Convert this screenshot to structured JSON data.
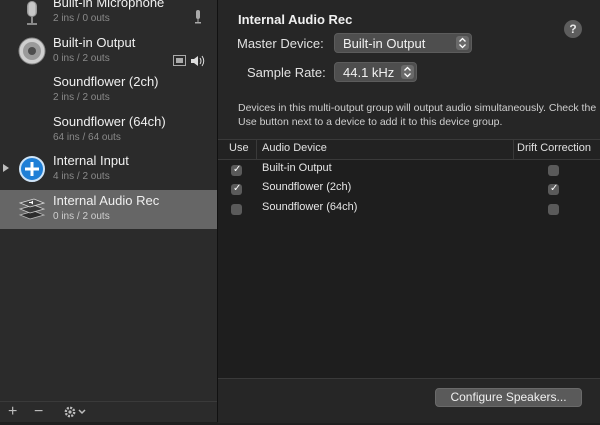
{
  "sidebar": {
    "devices": [
      {
        "name": "Built-in Microphone",
        "sub": "2 ins / 0 outs",
        "icon": "microphone-icon"
      },
      {
        "name": "Built-in Output",
        "sub": "0 ins / 2 outs",
        "icon": "speaker-icon"
      },
      {
        "name": "Soundflower (2ch)",
        "sub": "2 ins / 2 outs",
        "icon": ""
      },
      {
        "name": "Soundflower (64ch)",
        "sub": "64 ins / 64 outs",
        "icon": ""
      },
      {
        "name": "Internal Input",
        "sub": "4 ins / 2 outs",
        "icon": "aggregate-plus-icon"
      },
      {
        "name": "Internal Audio Rec",
        "sub": "0 ins / 2 outs",
        "icon": "multi-output-icon"
      }
    ],
    "bottom": {
      "add": "+",
      "remove": "−"
    }
  },
  "main": {
    "title": "Internal Audio Rec",
    "help": "?",
    "master_label": "Master Device:",
    "master_value": "Built-in Output",
    "rate_label": "Sample Rate:",
    "rate_value": "44.1 kHz",
    "description": "Devices in this multi-output group will output audio simultaneously. Check the Use button next to a device to add it to this device group.",
    "table": {
      "headers": {
        "use": "Use",
        "device": "Audio Device",
        "drift": "Drift Correction"
      },
      "rows": [
        {
          "device": "Built-in Output",
          "use": true,
          "drift": false
        },
        {
          "device": "Soundflower (2ch)",
          "use": true,
          "drift": true
        },
        {
          "device": "Soundflower (64ch)",
          "use": false,
          "drift": false
        }
      ]
    },
    "configure_button": "Configure Speakers..."
  },
  "colors": {
    "selected": "#666666",
    "accent_blue": "#1f7fd6"
  }
}
